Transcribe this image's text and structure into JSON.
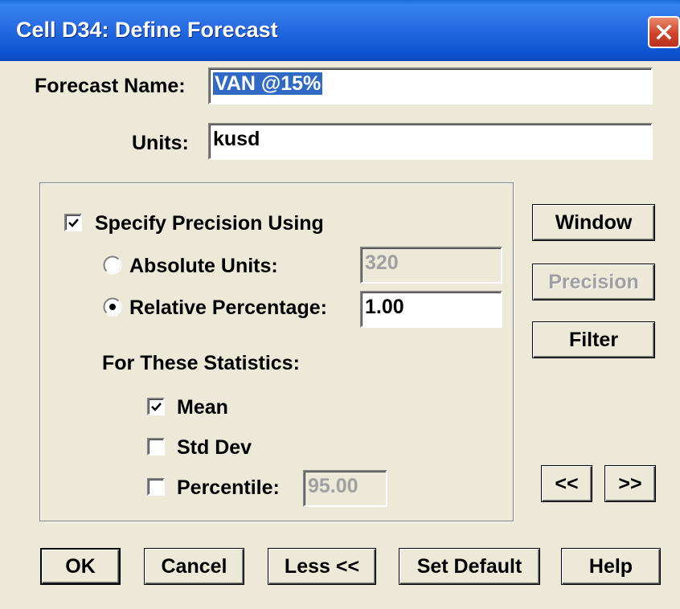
{
  "window": {
    "title": "Cell D34: Define Forecast"
  },
  "form": {
    "forecast_name_label": "Forecast Name:",
    "forecast_name_value": "VAN @15%",
    "units_label": "Units:",
    "units_value": "kusd"
  },
  "precision": {
    "specify_label": "Specify Precision Using",
    "specify_checked": true,
    "absolute_label": "Absolute Units:",
    "absolute_value": "320",
    "absolute_selected": false,
    "relative_label": "Relative Percentage:",
    "relative_value": "1.00",
    "relative_selected": true,
    "statistics_heading": "For These Statistics:",
    "stats": [
      {
        "label": "Mean",
        "checked": true
      },
      {
        "label": "Std Dev",
        "checked": false
      },
      {
        "label": "Percentile:",
        "checked": false
      }
    ],
    "percentile_value": "95.00"
  },
  "side_buttons": {
    "window": "Window",
    "precision": "Precision",
    "filter": "Filter",
    "prev": "<<",
    "next": ">>"
  },
  "bottom_buttons": {
    "ok": "OK",
    "cancel": "Cancel",
    "less": "Less <<",
    "set_default": "Set Default",
    "help": "Help"
  },
  "colors": {
    "titlebar": "#0d54d0",
    "dialog_bg": "#ece9d8",
    "selection": "#316ac5",
    "close_button": "#d1432a"
  },
  "icons": {
    "close": "close-icon",
    "check": "checkmark-icon",
    "radio": "radio-dot-icon"
  }
}
